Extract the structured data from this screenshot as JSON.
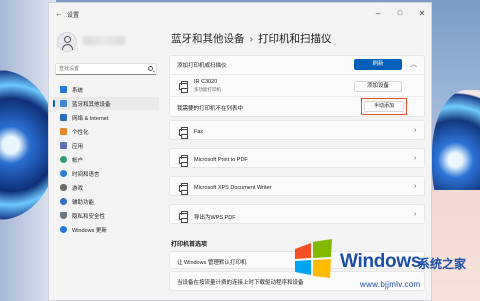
{
  "window": {
    "title": "设置"
  },
  "sidebar": {
    "search_placeholder": "查找设置",
    "items": [
      {
        "label": "系统",
        "icon": "monitor-icon",
        "color": "#1f7ad9",
        "active": false
      },
      {
        "label": "蓝牙和其他设备",
        "icon": "bluetooth-icon",
        "color": "#3a8ad8",
        "active": true
      },
      {
        "label": "网络 & Internet",
        "icon": "wifi-icon",
        "color": "#2a6fbf",
        "active": false
      },
      {
        "label": "个性化",
        "icon": "brush-icon",
        "color": "#e58a2c",
        "active": false
      },
      {
        "label": "应用",
        "icon": "apps-icon",
        "color": "#5a6fb8",
        "active": false
      },
      {
        "label": "帐户",
        "icon": "person-icon",
        "color": "#2f9e6f",
        "active": false
      },
      {
        "label": "时间和语言",
        "icon": "globe-icon",
        "color": "#2a7fd4",
        "active": false
      },
      {
        "label": "游戏",
        "icon": "gamepad-icon",
        "color": "#6b6b6b",
        "active": false
      },
      {
        "label": "辅助功能",
        "icon": "accessibility-icon",
        "color": "#2f6fc4",
        "active": false
      },
      {
        "label": "隐私和安全性",
        "icon": "shield-icon",
        "color": "#6a7380",
        "active": false
      },
      {
        "label": "Windows 更新",
        "icon": "update-icon",
        "color": "#1f7ad9",
        "active": false
      }
    ]
  },
  "main": {
    "breadcrumb_parent": "蓝牙和其他设备",
    "breadcrumb_sep": "›",
    "breadcrumb_current": "打印机和扫描仪",
    "add_card": {
      "label": "添加打印机或扫描仪",
      "refresh_label": "刷新",
      "device_name": "IR C3020",
      "device_status": "多功能打印机",
      "add_device_label": "添加设备",
      "not_listed_label": "我需要的打印机不在列表中",
      "manual_add_label": "手动添加"
    },
    "printers": [
      {
        "name": "Fax"
      },
      {
        "name": "Microsoft Print to PDF"
      },
      {
        "name": "Microsoft XPS Document Writer"
      },
      {
        "name": "导出为WPS PDF"
      }
    ],
    "prefs_title": "打印机首选项",
    "prefs": [
      {
        "label": "让 Windows 管理默认打印机"
      },
      {
        "label": "当设备在按流量计费的连接上时下载驱动程序和设备"
      }
    ]
  },
  "watermark": {
    "brand": "Windows",
    "brand_cn": "系统之家",
    "url": "www.bjjmlv.com",
    "colors": [
      "#f25022",
      "#7fba00",
      "#00a4ef",
      "#ffb900"
    ]
  },
  "colors": {
    "accent": "#005fb8",
    "highlight": "#e0532a"
  }
}
